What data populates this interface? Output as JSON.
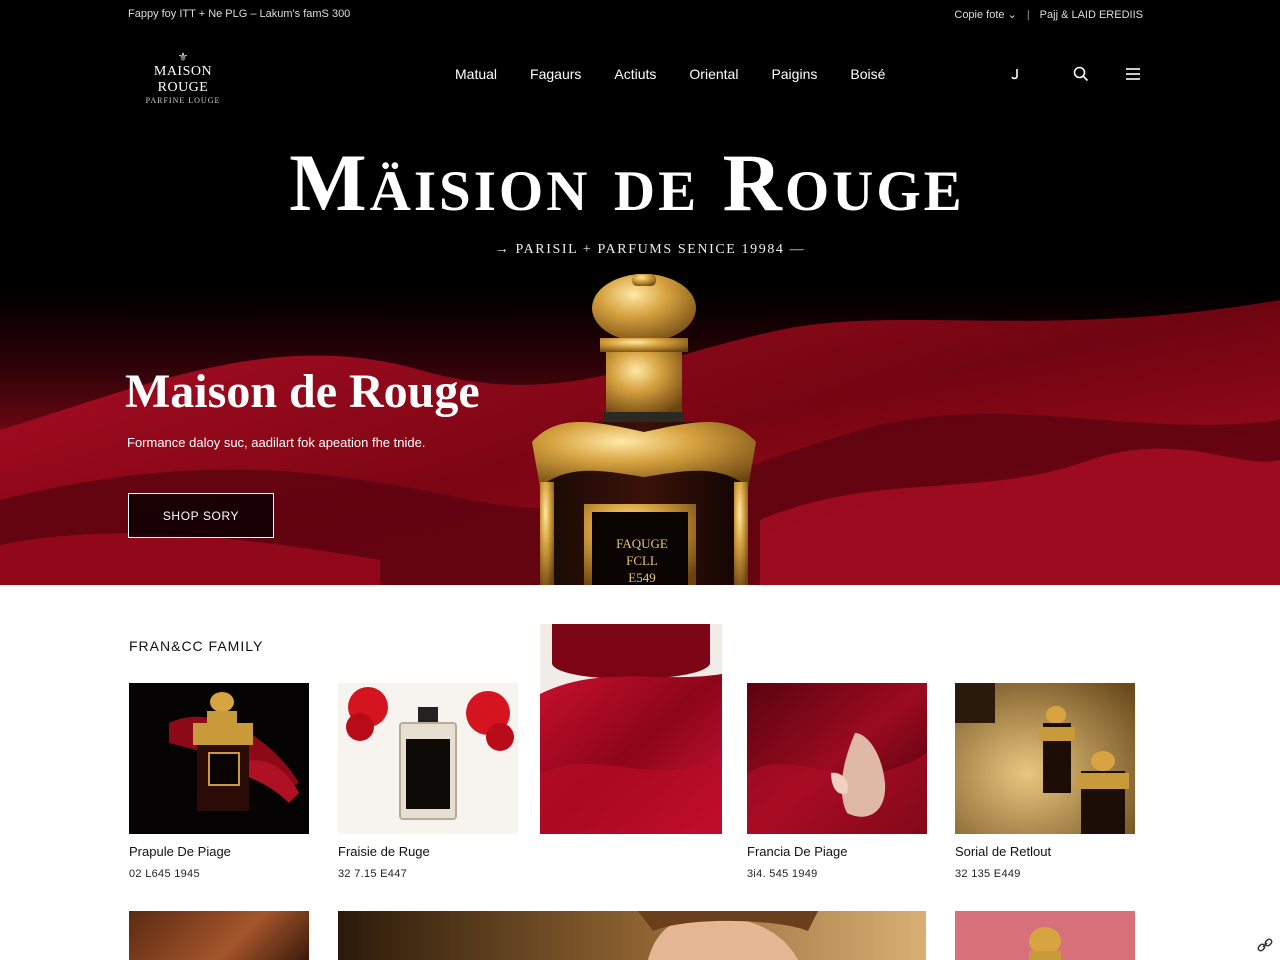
{
  "topbar": {
    "left_text": "Fappy foy ITT + Ne PLG – Lakum's famS 300",
    "currency": "Copie fote",
    "currency_caret": "⌄",
    "separator": "|",
    "account": "Pajj & LAID EREDIIS"
  },
  "logo": {
    "crest": "⚜",
    "name": "MAISON ROUGE",
    "sub": "PARFINE LOUGE"
  },
  "nav": {
    "items": [
      "Matual",
      "Fagaurs",
      "Actiuts",
      "Oriental",
      "Paigins",
      "Boisé"
    ]
  },
  "icons": {
    "account": "account-icon",
    "search": "search-icon",
    "menu": "menu-icon"
  },
  "hero": {
    "title": "Mäision de Rouge",
    "tagline": "→  PARISIL + PARFUMS SENICE 19984  —",
    "subtitle": "Maison de Rouge",
    "description": "Formance daloy suc, aadilart fok apeation fhe tnide.",
    "cta": "SHOP SORY",
    "bottle_label": [
      "FAQUGE",
      "FCLL",
      "E549"
    ]
  },
  "products": {
    "section_title": "FRAN&CC FAMILY",
    "items": [
      {
        "name": "Prapule De Piage",
        "price": "02 L645 1945"
      },
      {
        "name": "Fraisie de Ruge",
        "price": "32 7.15 E447"
      },
      {
        "name": "Francia De Piage",
        "price": "3i4. 545 1949"
      },
      {
        "name": "Sorial de Retlout",
        "price": "32 135 E449"
      }
    ]
  },
  "colors": {
    "hero_bg": "#000000",
    "silk_red": "#9b0a1c",
    "gold": "#c99a3a",
    "white": "#ffffff"
  }
}
